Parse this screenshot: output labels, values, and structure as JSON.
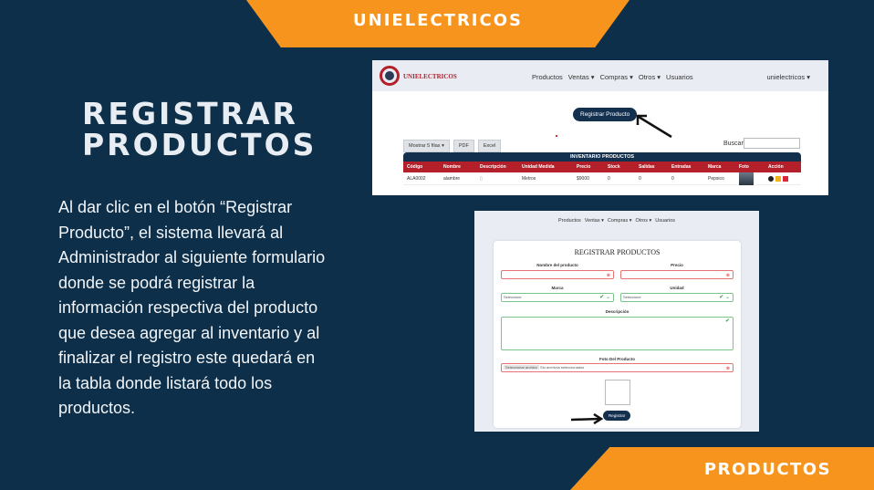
{
  "banners": {
    "top": "UNIELECTRICOS",
    "bottom": "PRODUCTOS"
  },
  "title": {
    "line1": "REGISTRAR",
    "line2": "PRODUCTOS"
  },
  "description": "Al dar clic en el botón “Registrar Producto”,  el sistema llevará al Administrador al siguiente formulario donde se podrá registrar la información respectiva del producto que desea agregar al inventario y al finalizar el registro este quedará en la tabla donde listará todo los productos.",
  "shot1": {
    "brand": "UNIELECTRICOS",
    "menu": [
      "Productos",
      "Ventas ▾",
      "Compras ▾",
      "Otros ▾",
      "Usuarios"
    ],
    "user": "unielectricos ▾",
    "register_button": "Registrar Producto",
    "table_buttons": [
      "Mostrar 5 filas ▾",
      "PDF",
      "Excel"
    ],
    "search_label": "Buscar:",
    "table_title": "INVENTARIO PRODUCTOS",
    "columns": [
      "Código",
      "Nombre",
      "Descripción",
      "Unidad Medida",
      "Precio",
      "Stock",
      "Salidas",
      "Entradas",
      "Marca",
      "Foto",
      "Acción"
    ],
    "row": [
      "ALA0002",
      "alambre",
      "",
      "Metros",
      "$9000",
      "0",
      "0",
      "0",
      "Pepsico"
    ]
  },
  "shot2": {
    "menu": [
      "Productos",
      "Ventas ▾",
      "Compras ▾",
      "Otros ▾",
      "Usuarios"
    ],
    "form_title": "REGISTRAR PRODUCTOS",
    "labels": {
      "name": "Nombre del producto",
      "price": "Precio",
      "brand": "Marca",
      "unit": "Unidad",
      "description": "Descripción",
      "photo": "Foto Del Producto"
    },
    "brand_select": "Seleccione",
    "unit_select": "Seleccione",
    "file_button": "Seleccionar archivo",
    "file_text": "Sin archivos seleccionados",
    "submit": "Registrar"
  }
}
